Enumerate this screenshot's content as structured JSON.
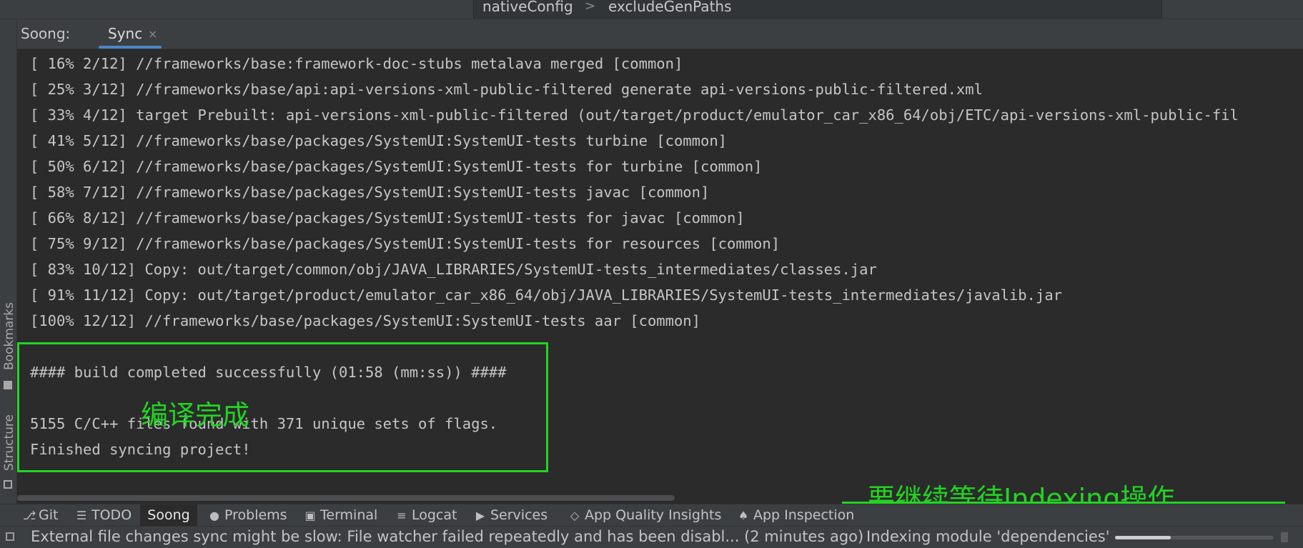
{
  "breadcrumb": {
    "items": [
      "nativeConfig",
      "excludeGenPaths"
    ],
    "separator": ">"
  },
  "tool_window": {
    "prefix": "Soong:",
    "tab_label": "Sync",
    "tab_close": "×"
  },
  "left_stripe": {
    "bookmarks": "Bookmarks",
    "structure": "Structure"
  },
  "console": {
    "lines": [
      "[ 16% 2/12] //frameworks/base:framework-doc-stubs metalava merged [common]",
      "[ 25% 3/12] //frameworks/base/api:api-versions-xml-public-filtered generate api-versions-public-filtered.xml",
      "[ 33% 4/12] target Prebuilt: api-versions-xml-public-filtered (out/target/product/emulator_car_x86_64/obj/ETC/api-versions-xml-public-fil",
      "[ 41% 5/12] //frameworks/base/packages/SystemUI:SystemUI-tests turbine [common]",
      "[ 50% 6/12] //frameworks/base/packages/SystemUI:SystemUI-tests for turbine [common]",
      "[ 58% 7/12] //frameworks/base/packages/SystemUI:SystemUI-tests javac [common]",
      "[ 66% 8/12] //frameworks/base/packages/SystemUI:SystemUI-tests for javac [common]",
      "[ 75% 9/12] //frameworks/base/packages/SystemUI:SystemUI-tests for resources [common]",
      "[ 83% 10/12] Copy: out/target/common/obj/JAVA_LIBRARIES/SystemUI-tests_intermediates/classes.jar",
      "[ 91% 11/12] Copy: out/target/product/emulator_car_x86_64/obj/JAVA_LIBRARIES/SystemUI-tests_intermediates/javalib.jar",
      "[100% 12/12] //frameworks/base/packages/SystemUI:SystemUI-tests aar [common]",
      "",
      "#### build completed successfully (01:58 (mm:ss)) ####",
      "",
      "5155 C/C++ files found with 371 unique sets of flags.",
      "Finished syncing project!"
    ]
  },
  "annotations": {
    "build_done": "编译完成",
    "wait_indexing": "要继续等待Indexing操作",
    "color": "#22d422"
  },
  "bottom_tools": [
    {
      "label": "Git",
      "icon": "git-branch-icon",
      "glyph": "⎇"
    },
    {
      "label": "TODO",
      "icon": "list-icon",
      "glyph": "☰"
    },
    {
      "label": "Soong",
      "icon": "",
      "glyph": ""
    },
    {
      "label": "Problems",
      "icon": "info-icon",
      "glyph": "●"
    },
    {
      "label": "Terminal",
      "icon": "terminal-icon",
      "glyph": "▣"
    },
    {
      "label": "Logcat",
      "icon": "logcat-icon",
      "glyph": "≡"
    },
    {
      "label": "Services",
      "icon": "services-icon",
      "glyph": "▶"
    },
    {
      "label": "App Quality Insights",
      "icon": "diamond-icon",
      "glyph": "◇"
    },
    {
      "label": "App Inspection",
      "icon": "android-icon",
      "glyph": "♠"
    }
  ],
  "status_bar": {
    "message": "External file changes sync might be slow: File watcher failed repeatedly and has been disabl... (2 minutes ago)",
    "indexing": "Indexing module 'dependencies'",
    "progress": 0.35
  },
  "colors": {
    "editor_bg": "#2b2b2b",
    "panel_bg": "#3c3f41",
    "accent": "#4a88c7",
    "text": "#bbbbbb"
  }
}
